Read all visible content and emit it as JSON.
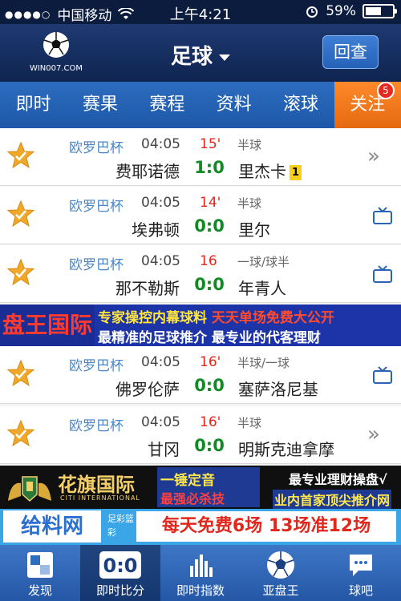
{
  "status_bar": {
    "carrier": "中国移动",
    "time": "上午4:21",
    "battery": "59%",
    "battery_level": 0.59
  },
  "header": {
    "logo_text": "WIN007.COM",
    "title": "足球",
    "review_label": "回查"
  },
  "tabs": [
    {
      "label": "即时"
    },
    {
      "label": "赛果"
    },
    {
      "label": "赛程"
    },
    {
      "label": "资料"
    },
    {
      "label": "滚球"
    },
    {
      "label": "关注",
      "badge": "5"
    }
  ],
  "matches": [
    {
      "league": "欧罗巴杯",
      "time": "04:05",
      "minute": "15'",
      "handicap": "半球",
      "home": "费耶诺德",
      "score": "1:0",
      "away": "里杰卡",
      "card": "1",
      "action": "chevron"
    },
    {
      "league": "欧罗巴杯",
      "time": "04:05",
      "minute": "14'",
      "handicap": "半球",
      "home": "埃弗顿",
      "score": "0:0",
      "away": "里尔",
      "action": "tv"
    },
    {
      "league": "欧罗巴杯",
      "time": "04:05",
      "minute": "16",
      "handicap": "一球/球半",
      "home": "那不勒斯",
      "score": "0:0",
      "away": "年青人",
      "action": "tv"
    },
    {
      "league": "欧罗巴杯",
      "time": "04:05",
      "minute": "16'",
      "handicap": "半球/一球",
      "home": "佛罗伦萨",
      "score": "0:0",
      "away": "塞萨洛尼基",
      "action": "tv"
    },
    {
      "league": "欧罗巴杯",
      "time": "04:05",
      "minute": "16'",
      "handicap": "半球",
      "home": "甘冈",
      "score": "0:0",
      "away": "明斯克迪拿摩",
      "action": "chevron"
    }
  ],
  "ads": {
    "ad1": {
      "brand": "盘王国际",
      "line1a": "专家操控内幕球料",
      "line1b": "天天单场免费大公开",
      "line2": "最精准的足球推介 最专业的代客理财"
    },
    "ad2": {
      "brand": "花旗国际",
      "brand_sub": "CITI INTERNATIONAL",
      "mid_line1": "一锤定音",
      "mid_line2": "最强必杀技",
      "right_line1": "最专业理财操盘√",
      "right_line2": "业内首家顶尖推介网"
    },
    "ad3": {
      "brand": "给料网",
      "small": "足彩篮彩",
      "main": "每天免费6场 13场准12场"
    }
  },
  "bottom_tabs": [
    {
      "label": "发现",
      "icon": "discover-icon"
    },
    {
      "label": "即时比分",
      "icon": "scoreboard-icon",
      "icon_text": "0:0"
    },
    {
      "label": "即时指数",
      "icon": "bar-chart-icon"
    },
    {
      "label": "亚盘王",
      "icon": "football-icon"
    },
    {
      "label": "球吧",
      "icon": "chat-icon"
    }
  ]
}
